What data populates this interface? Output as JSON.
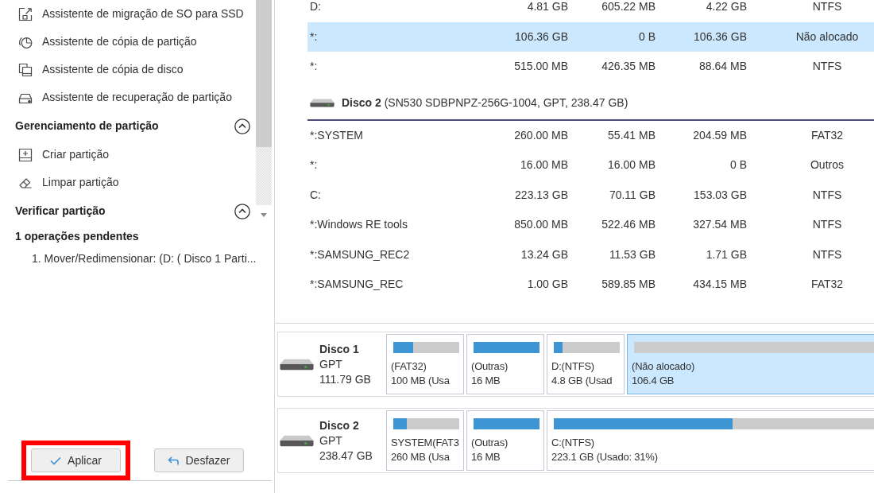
{
  "sidebar": {
    "groups": [
      {
        "items": [
          {
            "label": "Assistente de migração de SO para SSD"
          },
          {
            "label": "Assistente de cópia de partição"
          },
          {
            "label": "Assistente de cópia de disco"
          },
          {
            "label": "Assistente de recuperação de partição"
          }
        ]
      },
      {
        "title": "Gerenciamento de partição",
        "expanded": true,
        "items": [
          {
            "label": "Criar partição"
          },
          {
            "label": "Limpar partição"
          }
        ]
      },
      {
        "title": "Verificar partição",
        "expanded": true
      }
    ]
  },
  "pending": {
    "title": "1 operações pendentes",
    "items": [
      "1. Mover/Redimensionar: (D: ( Disco 1 Parti..."
    ]
  },
  "buttons": [
    {
      "kind": "apply",
      "label": "Aplicar",
      "highlighted": true
    },
    {
      "kind": "undo",
      "label": "Desfazer",
      "highlighted": false
    }
  ],
  "table": {
    "rows": [
      {
        "kind": "partition",
        "selected": false,
        "cells": [
          "D:",
          "4.81 GB",
          "605.22 MB",
          "4.22 GB",
          "NTFS"
        ]
      },
      {
        "kind": "partition",
        "selected": true,
        "cells": [
          "*:",
          "106.36 GB",
          "0 B",
          "106.36 GB",
          "Não alocado"
        ]
      },
      {
        "kind": "partition",
        "selected": false,
        "cells": [
          "*:",
          "515.00 MB",
          "426.35 MB",
          "88.64 MB",
          "NTFS"
        ]
      },
      {
        "kind": "disk",
        "selected": false,
        "text": "**Disco 2** (SN530 SDBPNPZ-256G-1004, GPT, 238.47 GB)"
      },
      {
        "kind": "partition",
        "selected": false,
        "cells": [
          "*:SYSTEM",
          "260.00 MB",
          "55.41 MB",
          "204.59 MB",
          "FAT32"
        ]
      },
      {
        "kind": "partition",
        "selected": false,
        "cells": [
          "*:",
          "16.00 MB",
          "16.00 MB",
          "0 B",
          "Outros"
        ]
      },
      {
        "kind": "partition",
        "selected": false,
        "cells": [
          "C:",
          "223.13 GB",
          "70.11 GB",
          "153.03 GB",
          "NTFS"
        ]
      },
      {
        "kind": "partition",
        "selected": false,
        "cells": [
          "*:Windows RE tools",
          "850.00 MB",
          "522.46 MB",
          "327.54 MB",
          "NTFS"
        ]
      },
      {
        "kind": "partition",
        "selected": false,
        "cells": [
          "*:SAMSUNG_REC2",
          "13.24 GB",
          "11.53 GB",
          "1.71 GB",
          "NTFS"
        ]
      },
      {
        "kind": "partition",
        "selected": false,
        "cells": [
          "*:SAMSUNG_REC",
          "1.00 GB",
          "589.85 MB",
          "434.15 MB",
          "FAT32"
        ]
      }
    ]
  },
  "disk_map": {
    "disks": [
      {
        "name": "Disco 1",
        "style": "GPT",
        "size": "111.79 GB",
        "partitions": [
          {
            "label": "(FAT32)",
            "detail": "100 MB (Usa",
            "level": 0.3,
            "selected": false
          },
          {
            "label": "(Outras)",
            "detail": "16 MB",
            "level": 1,
            "selected": false
          },
          {
            "label": "D:(NTFS)",
            "detail": "4.8 GB (Usad",
            "level": 0.13,
            "selected": false
          },
          {
            "label": "(Não alocado)",
            "detail": "106.4 GB",
            "level": 0,
            "selected": true
          }
        ]
      },
      {
        "name": "Disco 2",
        "style": "GPT",
        "size": "238.47 GB",
        "partitions": [
          {
            "label": "SYSTEM(FAT3",
            "detail": "260 MB (Usa",
            "level": 0.21,
            "selected": false
          },
          {
            "label": "(Outras)",
            "detail": "16 MB",
            "level": 1,
            "selected": false
          },
          {
            "label": "C:(NTFS)",
            "detail": "223.1 GB (Usado: 31%)",
            "level": 0.31,
            "selected": false
          }
        ]
      }
    ]
  }
}
